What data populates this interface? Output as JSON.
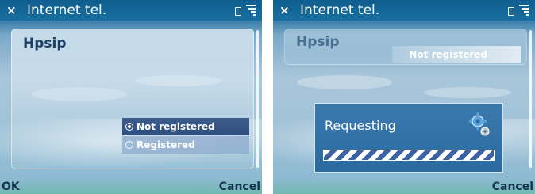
{
  "left_screen": {
    "title_close": "×",
    "title": "Internet tel.",
    "item": "Hpsip",
    "options": [
      {
        "label": "Not registered",
        "selected": true
      },
      {
        "label": "Registered",
        "selected": false
      }
    ],
    "softkey_left": "OK",
    "softkey_right": "Cancel"
  },
  "right_screen": {
    "title_close": "×",
    "title": "Internet tel.",
    "item": "Hpsip",
    "status_value": "Not registered",
    "dialog_text": "Requesting",
    "softkey_right": "Cancel"
  },
  "colors": {
    "title_bar": "#176f9f",
    "selected_option": "#2f4f80",
    "dialog": "#2b6aa0",
    "progress_stripe": "#3c62a6"
  },
  "icons": {
    "close": "close-icon",
    "signal": "signal-strength-icon",
    "battery": "battery-icon",
    "radio_on": "radio-selected-icon",
    "radio_off": "radio-unselected-icon",
    "activity": "gear-activity-icon"
  }
}
